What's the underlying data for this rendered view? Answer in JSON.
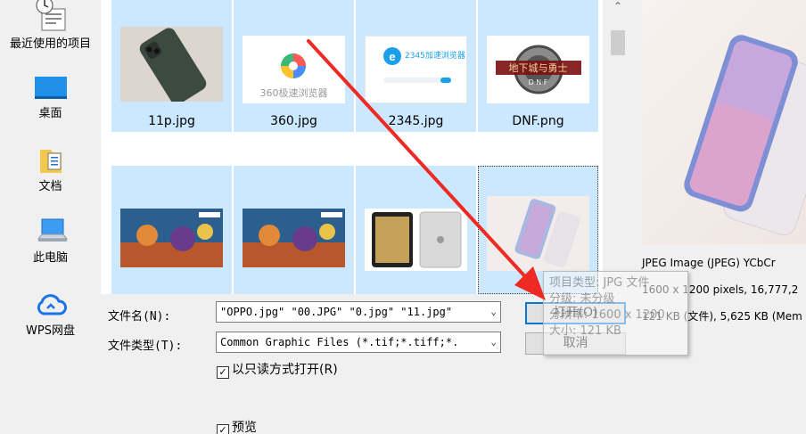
{
  "nav": {
    "items": [
      {
        "label": "最近使用的项目",
        "icon": "recent-items-icon"
      },
      {
        "label": "桌面",
        "icon": "desktop-icon"
      },
      {
        "label": "文档",
        "icon": "documents-icon"
      },
      {
        "label": "此电脑",
        "icon": "this-pc-icon"
      },
      {
        "label": "WPS网盘",
        "icon": "wps-cloud-icon"
      }
    ]
  },
  "files": [
    {
      "name": "11p.jpg"
    },
    {
      "name": "360.jpg",
      "thumb_text": "360极速浏览器"
    },
    {
      "name": "2345.jpg",
      "thumb_text": "2345加速浏览器"
    },
    {
      "name": "DNF.png",
      "thumb_text": "地下城与勇士",
      "thumb_sub": "D·N·F"
    },
    {
      "name": ""
    },
    {
      "name": ""
    },
    {
      "name": ""
    },
    {
      "name": ""
    }
  ],
  "preview": {
    "type_line": "JPEG Image (JPEG) YCbCr",
    "dims_line": "1600 x 1200 pixels, 16,777,2",
    "size_line": "121 KB (文件), 5,625 KB (Mem"
  },
  "form": {
    "filename_label": "文件名(N):",
    "filename_value": "\"OPPO.jpg\" \"00.JPG\" \"0.jpg\" \"11.jpg\"",
    "filetype_label": "文件类型(T):",
    "filetype_value": "Common Graphic Files (*.tif;*.tiff;*.",
    "open_button": "打开(O)",
    "cancel_button": "取消",
    "readonly_label": "以只读方式打开(R)",
    "preview_label": "预览"
  },
  "tooltip": {
    "line1": "项目类型: JPG 文件",
    "line2": "分级: 未分级",
    "line3": "分辨率: 1600 x 1200",
    "line4": "大小: 121 KB"
  },
  "colors": {
    "selection": "#cce8ff",
    "accent": "#0078d7",
    "annotation_arrow": "#ee2a24"
  }
}
